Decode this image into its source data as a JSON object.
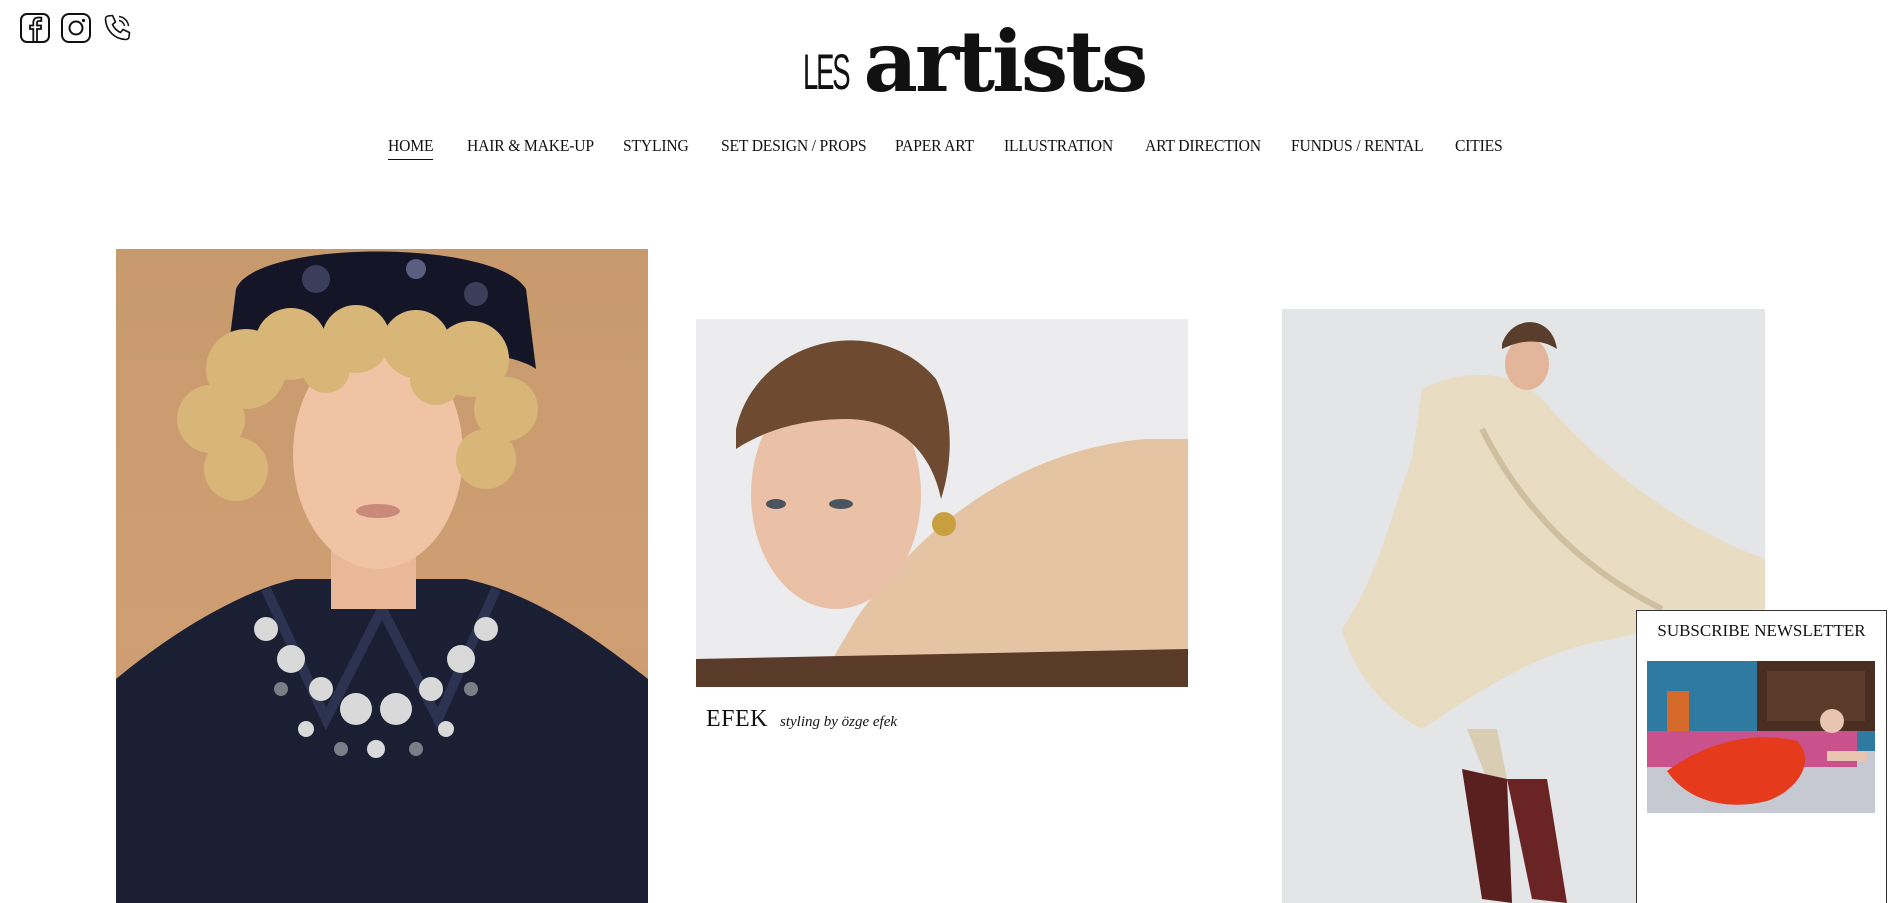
{
  "social": {
    "icons": [
      "facebook-icon",
      "instagram-icon",
      "phone-icon"
    ]
  },
  "logo": {
    "prefix": "LES",
    "name": "artists"
  },
  "nav": {
    "items": [
      {
        "label": "HOME",
        "active": true
      },
      {
        "label": "HAIR & MAKE-UP",
        "active": false
      },
      {
        "label": "STYLING",
        "active": false
      },
      {
        "label": "SET DESIGN / PROPS",
        "active": false
      },
      {
        "label": "PAPER ART",
        "active": false
      },
      {
        "label": "ILLUSTRATION",
        "active": false
      },
      {
        "label": "ART DIRECTION",
        "active": false
      },
      {
        "label": "FUNDUS / RENTAL",
        "active": false
      },
      {
        "label": "CITIES",
        "active": false
      }
    ]
  },
  "gallery": {
    "items": [
      {
        "name": "portrait-curly-hair-photo"
      },
      {
        "name": "portrait-slicked-hair-photo",
        "title": "EFEK",
        "credit": "styling by özge efek"
      },
      {
        "name": "model-beige-coat-photo"
      }
    ]
  },
  "newsletter": {
    "title": "SUBSCRIBE NEWSLETTER"
  },
  "colors": {
    "text": "#111111",
    "background": "#ffffff"
  }
}
